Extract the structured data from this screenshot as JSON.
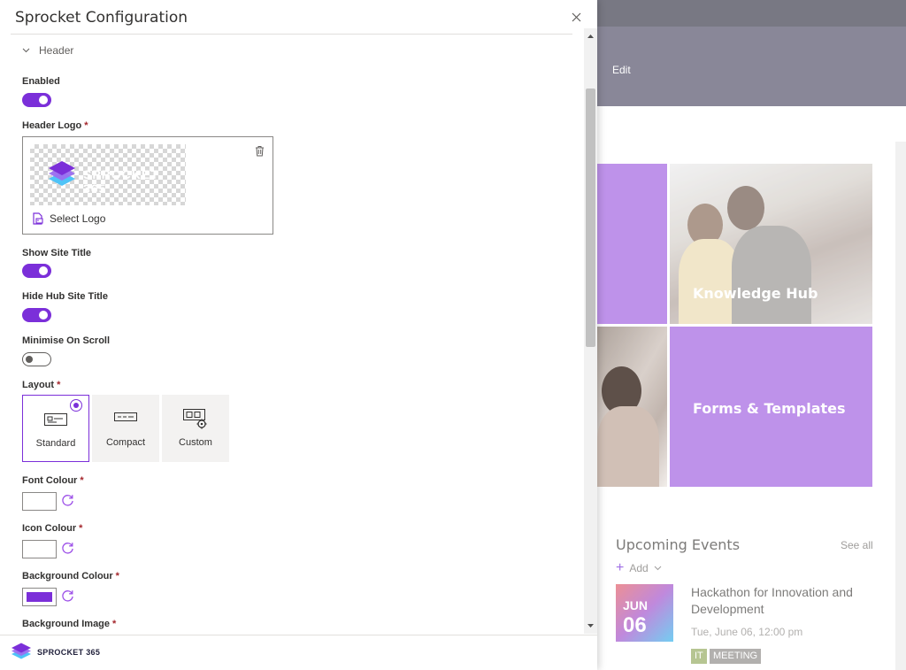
{
  "panel": {
    "title": "Sprocket Configuration",
    "section": "Header"
  },
  "fields": {
    "enabled": {
      "label": "Enabled",
      "value": true
    },
    "header_logo": {
      "label": "Header Logo",
      "required_mark": "*",
      "select_label": "Select Logo"
    },
    "show_site_title": {
      "label": "Show Site Title",
      "value": true
    },
    "hide_hub_site_title": {
      "label": "Hide Hub Site Title",
      "value": true
    },
    "minimise_on_scroll": {
      "label": "Minimise On Scroll",
      "value": false
    },
    "layout": {
      "label": "Layout",
      "required_mark": "*",
      "options": [
        "Standard",
        "Compact",
        "Custom"
      ],
      "selected": "Standard"
    },
    "font_colour": {
      "label": "Font Colour",
      "required_mark": "*",
      "value": "#ffffff"
    },
    "icon_colour": {
      "label": "Icon Colour",
      "required_mark": "*",
      "value": "#ffffff"
    },
    "background_colour": {
      "label": "Background Colour",
      "required_mark": "*",
      "value": "#7b2fd9"
    },
    "background_image": {
      "label": "Background Image",
      "required_mark": "*"
    }
  },
  "footer": {
    "brand": "SPROCKET 365"
  },
  "background_page": {
    "edit_label": "Edit",
    "tiles": [
      "Knowledge Hub",
      "Forms & Templates"
    ],
    "events": {
      "title": "Upcoming Events",
      "see_all": "See all",
      "add_label": "Add",
      "item": {
        "month": "JUN",
        "day": "06",
        "title": "Hackathon for Innovation and Development",
        "time": "Tue, June 06, 12:00 pm",
        "tags": [
          "IT",
          "MEETING"
        ]
      }
    }
  },
  "colors": {
    "accent": "#7b2fd9",
    "tile_purple": "#b07be6",
    "tag_green": "#a7b97a",
    "tag_gray": "#a19f9d"
  }
}
